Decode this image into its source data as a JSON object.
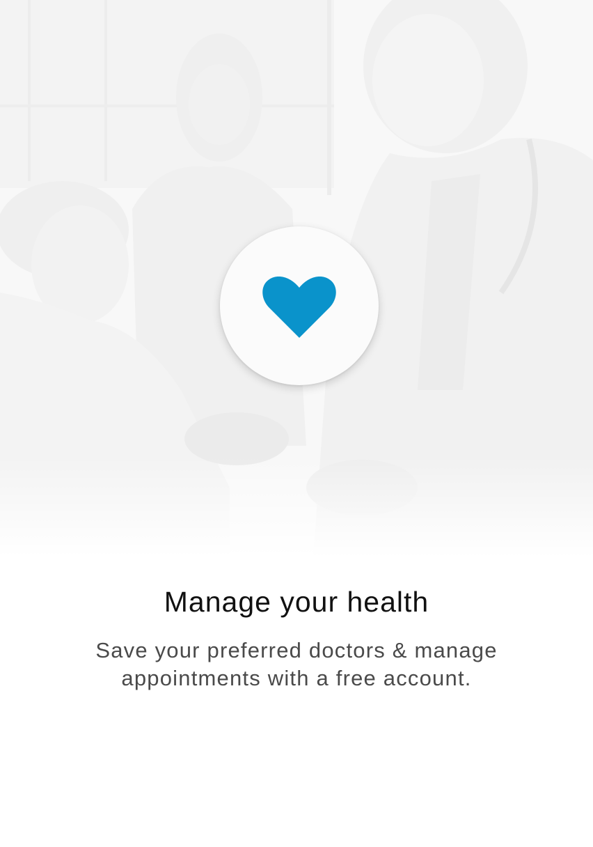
{
  "onboarding": {
    "title": "Manage your health",
    "subtitle": "Save your preferred doctors & manage appointments with a free account.",
    "icon": "heart-icon",
    "background_image": "doctor-greeting-mother-and-child-photo"
  },
  "colors": {
    "accent": "#0A93CB",
    "title_text": "#111111",
    "body_text": "#4A4A4A",
    "background": "#FFFFFF"
  }
}
